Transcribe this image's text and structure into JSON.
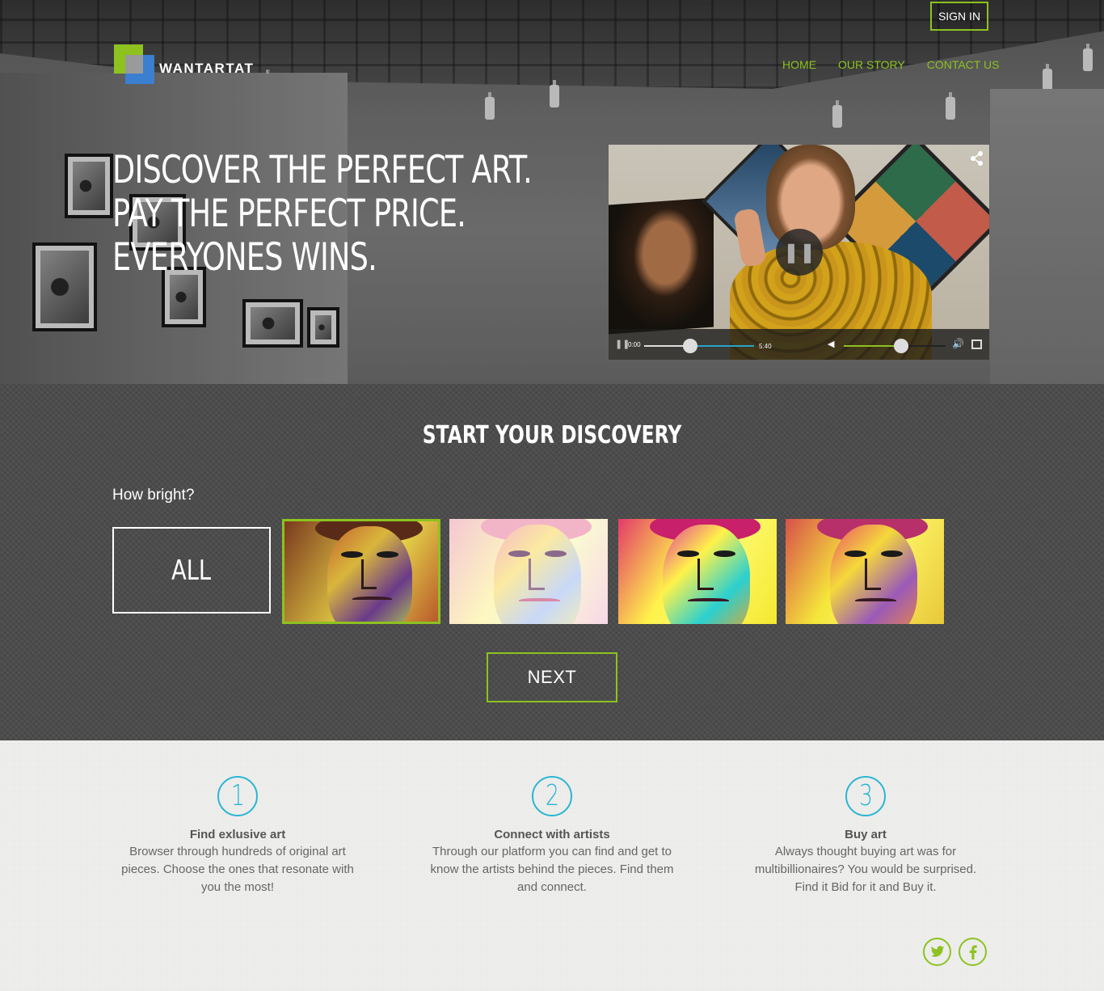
{
  "header": {
    "sign_in_label": "SIGN IN",
    "logo_text": "WANTARTAT",
    "logo_mark": "®",
    "nav": [
      {
        "label": "HOME"
      },
      {
        "label": "OUR STORY"
      },
      {
        "label": "CONTACT US"
      }
    ]
  },
  "hero": {
    "headline_lines": [
      "DISCOVER THE PERFECT ART.",
      "PAY THE PERFECT PRICE.",
      "EVERYONES WINS."
    ]
  },
  "video": {
    "current_time": "0:00",
    "duration": "5:40",
    "progress": 0.42,
    "volume": 0.56,
    "state": "playing",
    "icons": [
      "share-icon",
      "pause-icon",
      "mute-icon",
      "volume-icon",
      "fullscreen-icon"
    ]
  },
  "discovery": {
    "title": "START YOUR DISCOVERY",
    "question": "How bright?",
    "all_label": "ALL",
    "options": [
      {
        "id": "bright-1",
        "selected": true
      },
      {
        "id": "bright-2",
        "selected": false
      },
      {
        "id": "bright-3",
        "selected": false
      },
      {
        "id": "bright-4",
        "selected": false
      }
    ],
    "next_label": "NEXT"
  },
  "steps": [
    {
      "number": "1",
      "title": "Find exlusive art",
      "text": "Browser through hundreds of original art pieces. Choose the ones that resonate with you the most!"
    },
    {
      "number": "2",
      "title": "Connect with artists",
      "text": "Through our platform you can find and get to know the artists behind the pieces. Find them and connect."
    },
    {
      "number": "3",
      "title": "Buy art",
      "text": "Always thought buying art was for multibillionaires? You would be surprised. Find it Bid for it and Buy it."
    }
  ],
  "social": [
    "twitter-icon",
    "facebook-icon"
  ],
  "colors": {
    "accent_green": "#8dc21f",
    "accent_teal": "#29b6d2",
    "logo_blue": "#3a7fd0"
  }
}
